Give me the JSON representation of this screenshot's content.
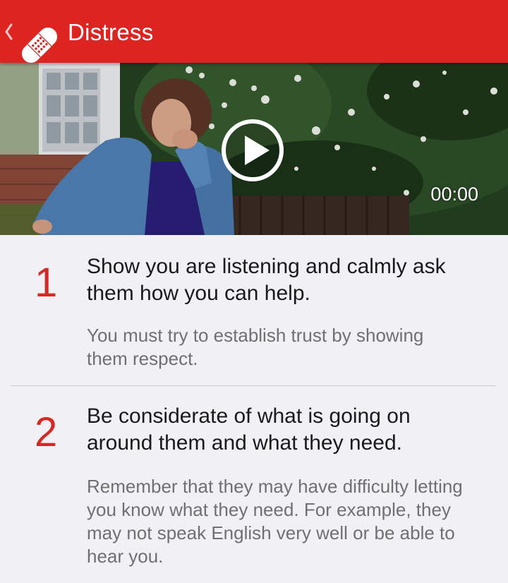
{
  "header": {
    "title": "Distress",
    "background_color": "#dd2421",
    "back_icon": "chevron-left-icon",
    "logo_icon": "plaster-bandage-icon"
  },
  "video": {
    "play_icon": "play-circle-icon",
    "time": "00:00"
  },
  "steps": [
    {
      "number": "1",
      "heading": "Show you are listening and calmly ask them how you can help.",
      "body": "You must try to establish trust by showing them respect."
    },
    {
      "number": "2",
      "heading": "Be considerate of what is going on around them and what they need.",
      "body": "Remember that they may have difficulty letting you know what they need. For example, they may not speak English very well or be able to hear you."
    }
  ],
  "colors": {
    "accent": "#d42a26",
    "page_background": "#f1f1f5",
    "heading_text": "#1a1a1a",
    "body_text": "#707070"
  }
}
